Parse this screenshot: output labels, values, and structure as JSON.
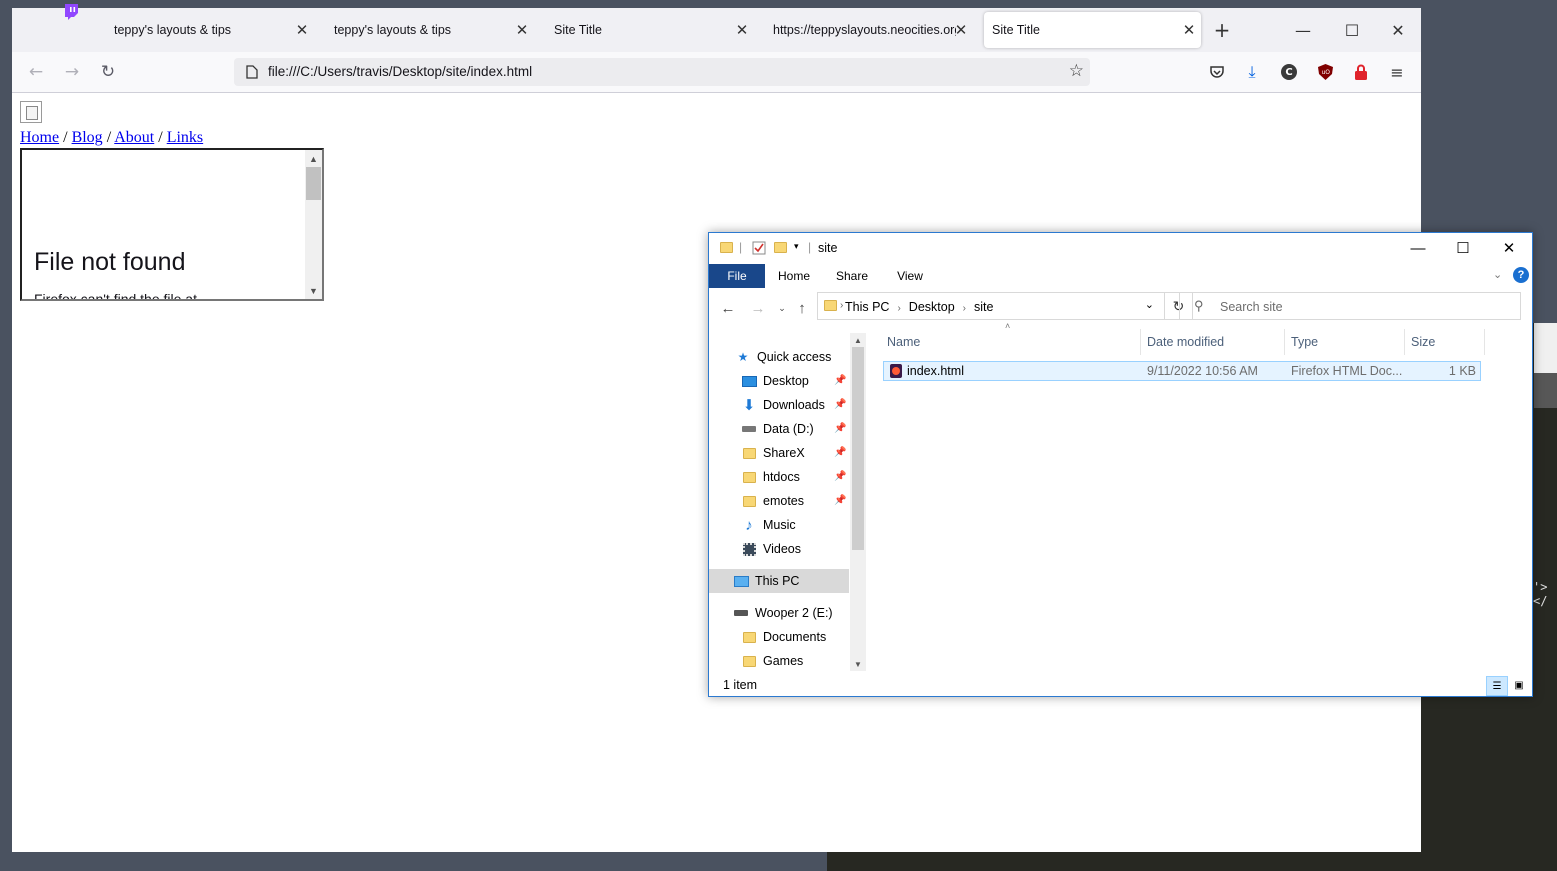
{
  "background_editor": {
    "code_fragment": "'></"
  },
  "browser": {
    "tabs": [
      {
        "title": "teppy's layouts & tips",
        "active": false
      },
      {
        "title": "teppy's layouts & tips",
        "active": false
      },
      {
        "title": "Site Title",
        "active": false
      },
      {
        "title": "https://teppyslayouts.neocities.org",
        "active": false
      },
      {
        "title": "Site Title",
        "active": true
      }
    ],
    "new_tab_symbol": "+",
    "url": "file:///C:/Users/travis/Desktop/site/index.html",
    "page": {
      "nav_links": [
        "Home",
        "Blog",
        "About",
        "Links"
      ],
      "separator": " / ",
      "frame_error_title": "File not found",
      "frame_error_body": "Firefox can't find the file at"
    }
  },
  "explorer": {
    "title": "site",
    "ribbon_tabs": [
      "File",
      "Home",
      "Share",
      "View"
    ],
    "breadcrumb": [
      "This PC",
      "Desktop",
      "site"
    ],
    "search_placeholder": "Search site",
    "nav_items": [
      {
        "label": "Quick access",
        "icon": "star-icon",
        "pinned": false
      },
      {
        "label": "Desktop",
        "icon": "desktop-icon",
        "pinned": true
      },
      {
        "label": "Downloads",
        "icon": "download-arrow-icon",
        "pinned": true
      },
      {
        "label": "Data (D:)",
        "icon": "drive-icon",
        "pinned": true
      },
      {
        "label": "ShareX",
        "icon": "folder-icon",
        "pinned": true
      },
      {
        "label": "htdocs",
        "icon": "folder-icon",
        "pinned": true
      },
      {
        "label": "emotes",
        "icon": "folder-icon",
        "pinned": true
      },
      {
        "label": "Music",
        "icon": "music-note-icon",
        "pinned": false
      },
      {
        "label": "Videos",
        "icon": "film-icon",
        "pinned": false
      },
      {
        "label": "This PC",
        "icon": "computer-icon",
        "pinned": false
      },
      {
        "label": "Wooper 2 (E:)",
        "icon": "drive-icon",
        "pinned": false
      },
      {
        "label": "Documents",
        "icon": "folder-icon",
        "pinned": false
      },
      {
        "label": "Games",
        "icon": "folder-icon",
        "pinned": false
      }
    ],
    "columns": [
      "Name",
      "Date modified",
      "Type",
      "Size"
    ],
    "files": [
      {
        "name": "index.html",
        "date": "9/11/2022 10:56 AM",
        "type": "Firefox HTML Doc...",
        "size": "1 KB"
      }
    ],
    "status": "1 item",
    "colors": {
      "file_tab": "#19478a",
      "selection": "#e5f3ff",
      "selection_border": "#99d1ff"
    }
  }
}
